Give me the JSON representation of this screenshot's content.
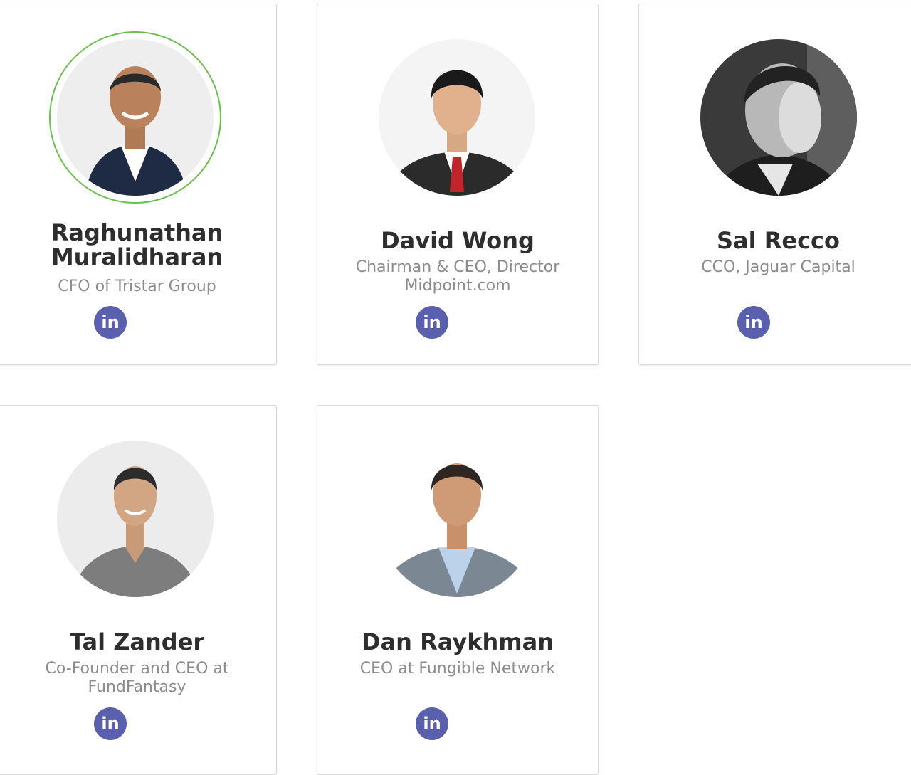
{
  "team": [
    {
      "name_lines": [
        "Raghunathan",
        "Muralidharan"
      ],
      "role_lines": [
        "CFO of Tristar Group"
      ],
      "social_icon": "linkedin-icon",
      "highlight_ring_color": "#6cbf4c"
    },
    {
      "name_lines": [
        "David Wong"
      ],
      "role_lines": [
        "Chairman & CEO, Director",
        "Midpoint.com"
      ],
      "social_icon": "linkedin-icon"
    },
    {
      "name_lines": [
        "Sal Recco"
      ],
      "role_lines": [
        "CCO, Jaguar Capital"
      ],
      "social_icon": "linkedin-icon"
    },
    {
      "name_lines": [
        "Tal Zander"
      ],
      "role_lines": [
        "Co-Founder and CEO at",
        "FundFantasy"
      ],
      "social_icon": "linkedin-icon"
    },
    {
      "name_lines": [
        "Dan Raykhman"
      ],
      "role_lines": [
        "CEO at Fungible Network"
      ],
      "social_icon": "linkedin-icon"
    }
  ],
  "linkedin_glyph": "in",
  "colors": {
    "linkedin_button": "#5a5fae",
    "name_text": "#2e2e2e",
    "role_text": "#8c8c8c",
    "card_border": "#d9d9d9"
  }
}
